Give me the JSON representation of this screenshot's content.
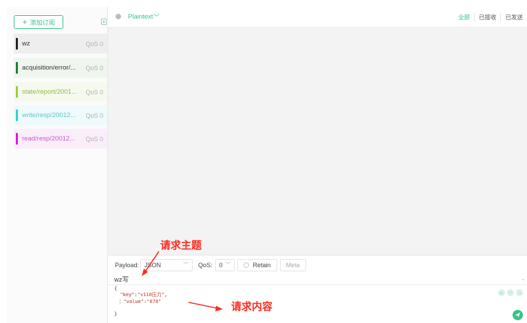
{
  "sidebar": {
    "add_button_label": "添加订阅",
    "subscriptions": [
      {
        "topic": "wz",
        "qos": "QoS 0",
        "color": "#222222",
        "bg": "#eeeeee",
        "text_color": "#333333"
      },
      {
        "topic": "acquisition/error/...",
        "qos": "QoS 0",
        "color": "#1a7f37",
        "bg": "#eef6ee",
        "text_color": "#333333"
      },
      {
        "topic": "state/report/2001...",
        "qos": "QoS 0",
        "color": "#9ccc3a",
        "bg": "#f6faee",
        "text_color": "#8db848"
      },
      {
        "topic": "write/resp/20012...",
        "qos": "QoS 0",
        "color": "#2ed1d6",
        "bg": "#eefafb",
        "text_color": "#5ac8cc"
      },
      {
        "topic": "read/resp/20012...",
        "qos": "QoS 0",
        "color": "#d91bd9",
        "bg": "#fbeefb",
        "text_color": "#c958c9"
      }
    ]
  },
  "header": {
    "payload_format": "Plaintext",
    "filters": [
      "全部",
      "已接收",
      "已发送"
    ]
  },
  "publish": {
    "payload_label": "Payload:",
    "payload_type": "JSON",
    "qos_label": "QoS:",
    "qos_value": "0",
    "retain_label": "Retain",
    "meta_label": "Meta",
    "topic": "wz写",
    "code_lines": {
      "open": "{",
      "key_name": "\"key\"",
      "key_value": "\"v110压力\"",
      "value_name": "\"value\"",
      "value_value": "\"678\"",
      "close": "}"
    }
  },
  "annotations": {
    "topic_note": "请求主题",
    "content_note": "请求内容"
  },
  "colors": {
    "accent": "#34c388",
    "annotation": "#ff2a1f"
  },
  "icons": [
    "plus-icon",
    "collapse-sidebar-icon",
    "format-dot-icon",
    "chevron-down-icon",
    "radio-icon",
    "prev-arrow-icon",
    "clear-icon",
    "next-arrow-icon",
    "send-icon"
  ]
}
